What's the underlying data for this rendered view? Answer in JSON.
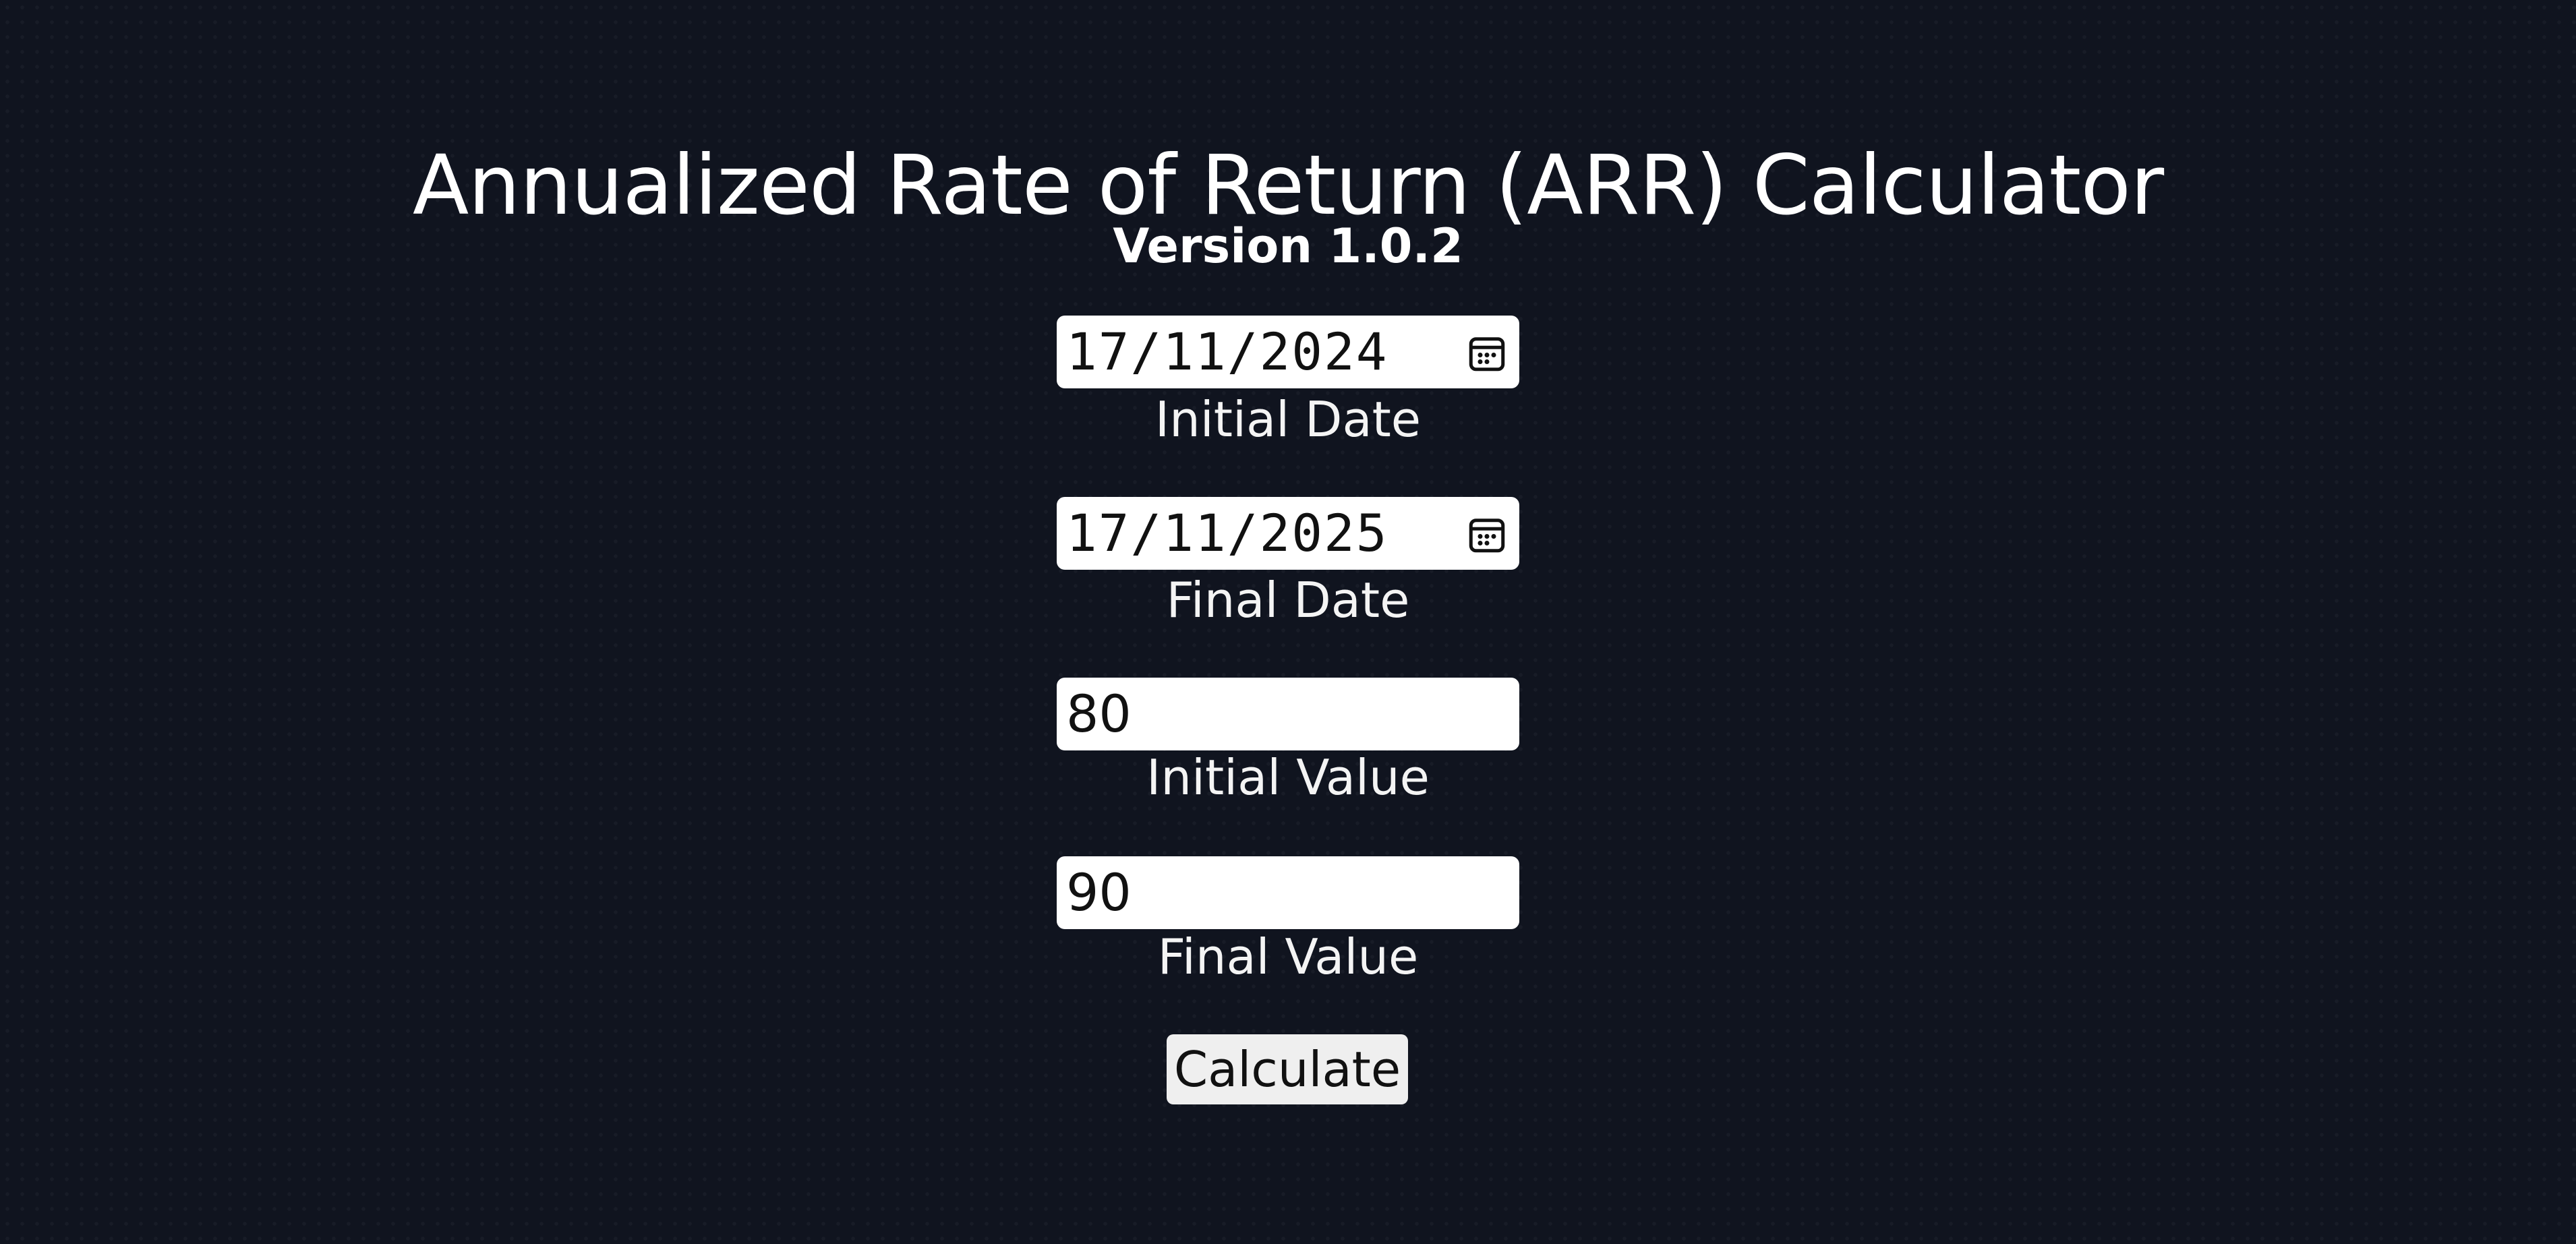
{
  "header": {
    "title": "Annualized Rate of Return (ARR) Calculator",
    "version": "Version 1.0.2"
  },
  "form": {
    "initial_date": {
      "value": "17/11/2024",
      "label": "Initial Date",
      "icon": "calendar-icon"
    },
    "final_date": {
      "value": "17/11/2025",
      "label": "Final Date",
      "icon": "calendar-icon"
    },
    "initial_value": {
      "value": "80",
      "label": "Initial Value"
    },
    "final_value": {
      "value": "90",
      "label": "Final Value"
    },
    "calculate_label": "Calculate"
  },
  "colors": {
    "background": "#10141f",
    "text": "#ffffff",
    "input_background": "#ffffff",
    "button_background": "#efefef"
  }
}
